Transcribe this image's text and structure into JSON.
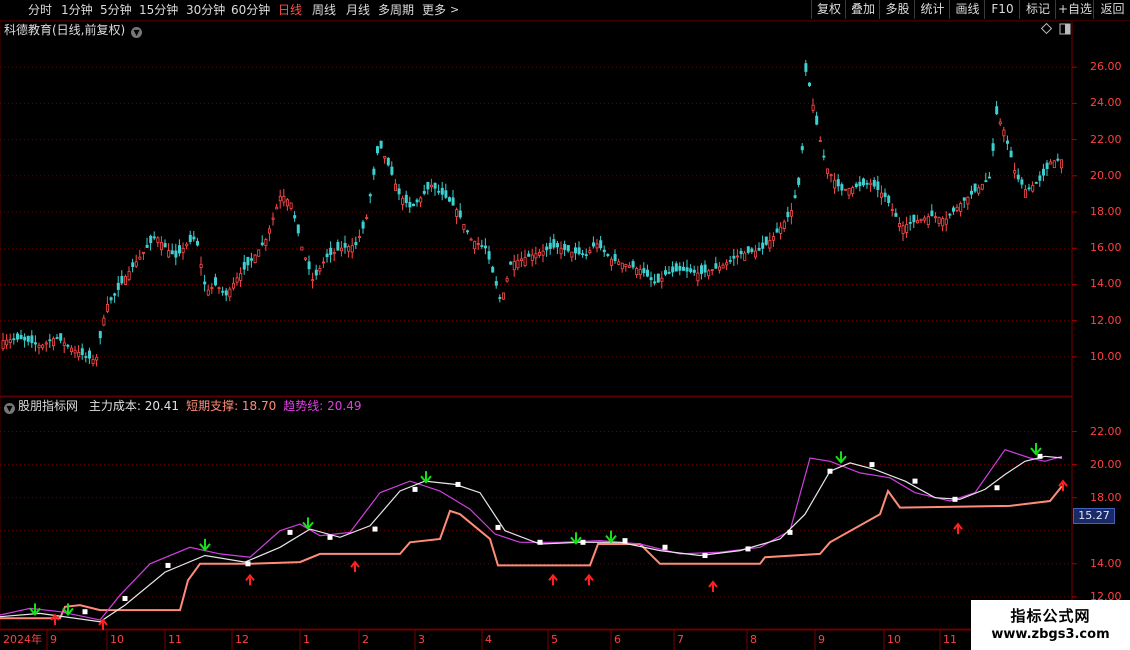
{
  "toolbar": {
    "periods": [
      "分时",
      "1分钟",
      "5分钟",
      "15分钟",
      "30分钟",
      "60分钟",
      "日线",
      "周线",
      "月线",
      "多周期",
      "更多"
    ],
    "active_period": "日线",
    "right_buttons": [
      "复权",
      "叠加",
      "多股",
      "统计",
      "画线",
      "F10",
      "标记",
      "+自选",
      "返回"
    ]
  },
  "main_panel": {
    "title": "科德教育(日线,前复权)",
    "price_ticks": [
      "26.00",
      "24.00",
      "22.00",
      "20.00",
      "18.00",
      "16.00",
      "14.00",
      "12.00",
      "10.00"
    ]
  },
  "indicator_panel": {
    "name": "股朋指标网",
    "legend": [
      {
        "label": "主力成本: 20.41",
        "color": "#e0e0e0"
      },
      {
        "label": "短期支撑: 18.70",
        "color": "#ff8c78"
      },
      {
        "label": "趋势线: 20.49",
        "color": "#e040e0"
      }
    ],
    "ticks": [
      "22.00",
      "20.00",
      "18.00",
      "14.00",
      "12.00"
    ],
    "current_price_tag": "15.27"
  },
  "time_axis": {
    "labels": [
      "2024年",
      "9",
      "10",
      "11",
      "12",
      "1",
      "2",
      "3",
      "4",
      "5",
      "6",
      "7",
      "8",
      "9",
      "10",
      "11"
    ]
  },
  "chart_data": {
    "type": "candlestick_with_indicator",
    "main_ylim": [
      9.0,
      27.5
    ],
    "indicator_ylim": [
      10.6,
      23.0
    ],
    "close_trace": [
      [
        0,
        10.9
      ],
      [
        20,
        11.0
      ],
      [
        40,
        10.6
      ],
      [
        55,
        11.1
      ],
      [
        70,
        10.5
      ],
      [
        85,
        10.0
      ],
      [
        95,
        9.8
      ],
      [
        105,
        12.8
      ],
      [
        115,
        13.5
      ],
      [
        125,
        14.5
      ],
      [
        140,
        15.6
      ],
      [
        155,
        16.7
      ],
      [
        165,
        16.0
      ],
      [
        175,
        15.5
      ],
      [
        185,
        16.2
      ],
      [
        195,
        16.6
      ],
      [
        205,
        13.6
      ],
      [
        215,
        14.0
      ],
      [
        225,
        13.4
      ],
      [
        235,
        14.3
      ],
      [
        250,
        15.3
      ],
      [
        265,
        16.5
      ],
      [
        280,
        19.0
      ],
      [
        290,
        18.5
      ],
      [
        300,
        16.2
      ],
      [
        312,
        14.2
      ],
      [
        325,
        15.5
      ],
      [
        340,
        16.0
      ],
      [
        355,
        16.2
      ],
      [
        365,
        17.5
      ],
      [
        378,
        21.8
      ],
      [
        388,
        20.5
      ],
      [
        398,
        19.0
      ],
      [
        410,
        18.2
      ],
      [
        420,
        18.8
      ],
      [
        430,
        19.5
      ],
      [
        445,
        18.8
      ],
      [
        455,
        18.2
      ],
      [
        470,
        16.5
      ],
      [
        485,
        16.0
      ],
      [
        500,
        13.0
      ],
      [
        510,
        15.2
      ],
      [
        525,
        15.5
      ],
      [
        540,
        15.8
      ],
      [
        555,
        16.1
      ],
      [
        570,
        15.8
      ],
      [
        585,
        15.6
      ],
      [
        595,
        16.3
      ],
      [
        610,
        15.4
      ],
      [
        625,
        15.1
      ],
      [
        640,
        14.8
      ],
      [
        655,
        14.0
      ],
      [
        665,
        14.6
      ],
      [
        680,
        14.8
      ],
      [
        700,
        14.6
      ],
      [
        720,
        15.0
      ],
      [
        740,
        15.7
      ],
      [
        760,
        15.9
      ],
      [
        775,
        16.8
      ],
      [
        790,
        18.0
      ],
      [
        800,
        20.0
      ],
      [
        805,
        26.0
      ],
      [
        815,
        23.0
      ],
      [
        825,
        20.5
      ],
      [
        840,
        19.2
      ],
      [
        855,
        19.4
      ],
      [
        870,
        19.6
      ],
      [
        885,
        18.8
      ],
      [
        900,
        17.2
      ],
      [
        915,
        17.5
      ],
      [
        930,
        17.8
      ],
      [
        945,
        17.6
      ],
      [
        960,
        18.5
      ],
      [
        975,
        19.2
      ],
      [
        990,
        20.0
      ],
      [
        995,
        23.5
      ],
      [
        1003,
        22.5
      ],
      [
        1015,
        20.0
      ],
      [
        1025,
        19.2
      ],
      [
        1040,
        19.8
      ],
      [
        1050,
        20.8
      ],
      [
        1062,
        20.9
      ]
    ],
    "main_cost": [
      [
        0,
        10.8
      ],
      [
        40,
        11.0
      ],
      [
        100,
        10.5
      ],
      [
        125,
        11.5
      ],
      [
        165,
        13.5
      ],
      [
        205,
        14.5
      ],
      [
        245,
        14.1
      ],
      [
        280,
        15.0
      ],
      [
        310,
        16.1
      ],
      [
        340,
        15.6
      ],
      [
        370,
        16.3
      ],
      [
        400,
        18.4
      ],
      [
        425,
        19.0
      ],
      [
        455,
        18.8
      ],
      [
        480,
        18.3
      ],
      [
        505,
        16.0
      ],
      [
        540,
        15.2
      ],
      [
        580,
        15.3
      ],
      [
        620,
        15.3
      ],
      [
        660,
        14.8
      ],
      [
        700,
        14.5
      ],
      [
        740,
        14.8
      ],
      [
        780,
        15.5
      ],
      [
        805,
        17.0
      ],
      [
        830,
        19.6
      ],
      [
        850,
        20.1
      ],
      [
        875,
        19.7
      ],
      [
        905,
        19.0
      ],
      [
        935,
        18.0
      ],
      [
        960,
        17.9
      ],
      [
        985,
        18.5
      ],
      [
        1005,
        19.4
      ],
      [
        1025,
        20.2
      ],
      [
        1045,
        20.5
      ],
      [
        1062,
        20.4
      ]
    ],
    "short_support": [
      [
        0,
        10.7
      ],
      [
        60,
        10.7
      ],
      [
        65,
        11.4
      ],
      [
        80,
        11.5
      ],
      [
        100,
        11.2
      ],
      [
        180,
        11.2
      ],
      [
        188,
        13.0
      ],
      [
        200,
        14.0
      ],
      [
        250,
        14.0
      ],
      [
        300,
        14.1
      ],
      [
        320,
        14.6
      ],
      [
        400,
        14.6
      ],
      [
        410,
        15.3
      ],
      [
        440,
        15.5
      ],
      [
        450,
        17.2
      ],
      [
        460,
        17.0
      ],
      [
        480,
        16.0
      ],
      [
        490,
        15.5
      ],
      [
        498,
        13.9
      ],
      [
        590,
        13.9
      ],
      [
        598,
        15.2
      ],
      [
        640,
        15.2
      ],
      [
        660,
        14.0
      ],
      [
        760,
        14.0
      ],
      [
        765,
        14.4
      ],
      [
        820,
        14.6
      ],
      [
        830,
        15.3
      ],
      [
        880,
        17.0
      ],
      [
        888,
        18.4
      ],
      [
        900,
        17.4
      ],
      [
        1010,
        17.5
      ],
      [
        1050,
        17.8
      ],
      [
        1062,
        18.7
      ]
    ],
    "trend_line": [
      [
        0,
        10.9
      ],
      [
        30,
        11.3
      ],
      [
        60,
        11.1
      ],
      [
        100,
        10.6
      ],
      [
        120,
        12.1
      ],
      [
        150,
        14.0
      ],
      [
        190,
        15.0
      ],
      [
        220,
        14.6
      ],
      [
        250,
        14.4
      ],
      [
        280,
        16.0
      ],
      [
        300,
        16.4
      ],
      [
        320,
        15.7
      ],
      [
        350,
        15.9
      ],
      [
        380,
        18.3
      ],
      [
        410,
        19.0
      ],
      [
        440,
        18.4
      ],
      [
        470,
        17.3
      ],
      [
        495,
        15.8
      ],
      [
        520,
        15.3
      ],
      [
        560,
        15.3
      ],
      [
        600,
        15.4
      ],
      [
        640,
        15.2
      ],
      [
        680,
        14.6
      ],
      [
        720,
        14.7
      ],
      [
        760,
        15.0
      ],
      [
        790,
        16.0
      ],
      [
        810,
        20.4
      ],
      [
        830,
        20.2
      ],
      [
        860,
        19.5
      ],
      [
        890,
        19.2
      ],
      [
        915,
        18.3
      ],
      [
        950,
        17.8
      ],
      [
        975,
        18.3
      ],
      [
        1005,
        20.9
      ],
      [
        1030,
        20.4
      ],
      [
        1045,
        20.2
      ],
      [
        1062,
        20.5
      ]
    ],
    "white_markers": [
      [
        85,
        11.1
      ],
      [
        125,
        11.9
      ],
      [
        168,
        13.9
      ],
      [
        248,
        14.0
      ],
      [
        290,
        15.9
      ],
      [
        330,
        15.6
      ],
      [
        375,
        16.1
      ],
      [
        415,
        18.5
      ],
      [
        458,
        18.8
      ],
      [
        498,
        16.2
      ],
      [
        540,
        15.3
      ],
      [
        583,
        15.3
      ],
      [
        625,
        15.4
      ],
      [
        665,
        15.0
      ],
      [
        705,
        14.5
      ],
      [
        748,
        14.9
      ],
      [
        790,
        15.9
      ],
      [
        830,
        19.6
      ],
      [
        872,
        20.0
      ],
      [
        915,
        19.0
      ],
      [
        955,
        17.9
      ],
      [
        997,
        18.6
      ],
      [
        1040,
        20.5
      ]
    ],
    "green_arrows": [
      [
        35,
        11.0
      ],
      [
        68,
        11.0
      ],
      [
        205,
        14.9
      ],
      [
        308,
        16.2
      ],
      [
        426,
        19.0
      ],
      [
        576,
        15.3
      ],
      [
        611,
        15.4
      ],
      [
        841,
        20.2
      ],
      [
        1036,
        20.7
      ]
    ],
    "red_arrows": [
      [
        55,
        10.9
      ],
      [
        103,
        10.6
      ],
      [
        250,
        13.3
      ],
      [
        355,
        14.1
      ],
      [
        553,
        13.3
      ],
      [
        589,
        13.3
      ],
      [
        713,
        12.9
      ],
      [
        958,
        16.4
      ],
      [
        1063,
        19.0
      ]
    ]
  },
  "watermark": {
    "line1": "指标公式网",
    "line2": "www.zbgs3.com"
  }
}
